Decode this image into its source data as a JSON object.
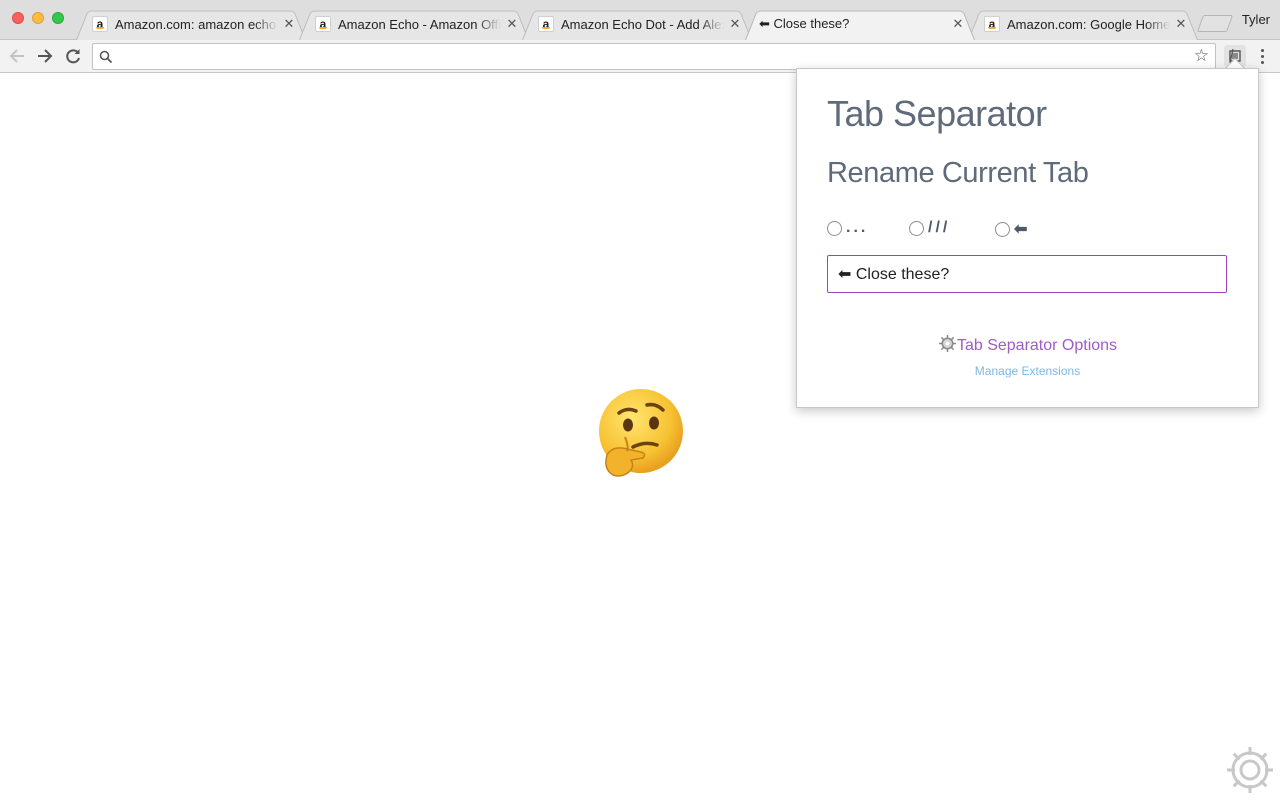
{
  "tabs": [
    {
      "title": "Amazon.com: amazon echo",
      "favicon": "amazon-favicon",
      "active": false
    },
    {
      "title": "Amazon Echo - Amazon Official Site",
      "favicon": "amazon-favicon",
      "active": false
    },
    {
      "title": "Amazon Echo Dot - Add Alexa",
      "favicon": "amazon-favicon",
      "active": false
    },
    {
      "title": "⬅ Close these?",
      "favicon": "",
      "active": true
    },
    {
      "title": "Amazon.com: Google Home: Google",
      "favicon": "amazon-favicon",
      "active": false
    }
  ],
  "tab_close_glyph": "✕",
  "profile_name": "Tyler",
  "toolbar": {
    "back_icon": "back-arrow-icon",
    "forward_icon": "forward-arrow-icon",
    "reload_icon": "reload-icon",
    "omnibox_value": "",
    "bookmark_icon": "star-icon",
    "extension_icon": "tab-separator-extension-icon",
    "menu_icon": "kebab-menu-icon"
  },
  "popup": {
    "title": "Tab Separator",
    "subtitle": "Rename Current Tab",
    "radio_options": [
      {
        "label": "...",
        "checked": false
      },
      {
        "label": "///",
        "checked": false
      },
      {
        "label": "⬅",
        "checked": false
      }
    ],
    "input_value": "⬅ Close these?",
    "options_link": "Tab Separator Options",
    "manage_link": "Manage Extensions"
  },
  "page": {
    "emoji": "thinking-face",
    "corner_icon": "gear-icon"
  },
  "colors": {
    "accent_purple": "#9c45c4",
    "link_blue": "#7fb6e6",
    "heading_gray": "#5f6b7a"
  }
}
